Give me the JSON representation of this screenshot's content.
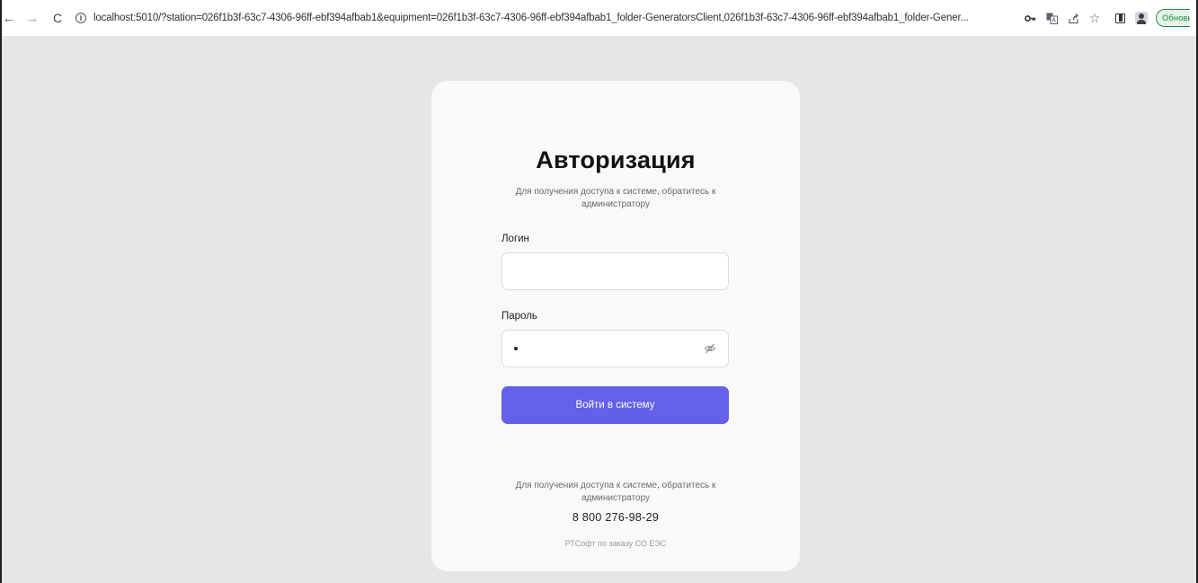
{
  "browser": {
    "url": "localhost:5010/?station=026f1b3f-63c7-4306-96ff-ebf394afbab1&equipment=026f1b3f-63c7-4306-96ff-ebf394afbab1_folder-GeneratorsClient,026f1b3f-63c7-4306-96ff-ebf394afbab1_folder-Gener...",
    "update_label": "Обновить",
    "icons": [
      "back-arrow-icon",
      "forward-arrow-icon",
      "reload-icon",
      "info-icon",
      "key-icon",
      "translate-icon",
      "share-icon",
      "star-icon",
      "side-panel-icon",
      "profile-icon"
    ]
  },
  "login": {
    "title": "Авторизация",
    "subtitle": "Для получения доступа к системе, обратитесь к администратору",
    "login_label": "Логин",
    "login_value": "",
    "password_label": "Пароль",
    "password_masked": "•",
    "submit_label": "Войти в систему",
    "footer_note": "Для получения доступа к системе, обратитесь к администратору",
    "phone": "8 800 276-98-29",
    "copyright": "РТСофт по заказу СО ЕЭС"
  },
  "colors": {
    "page_background": "#e6e6e6",
    "card_background": "#f9f9f9",
    "primary_button": "#6560e8",
    "update_button": "#1e8e3e"
  }
}
